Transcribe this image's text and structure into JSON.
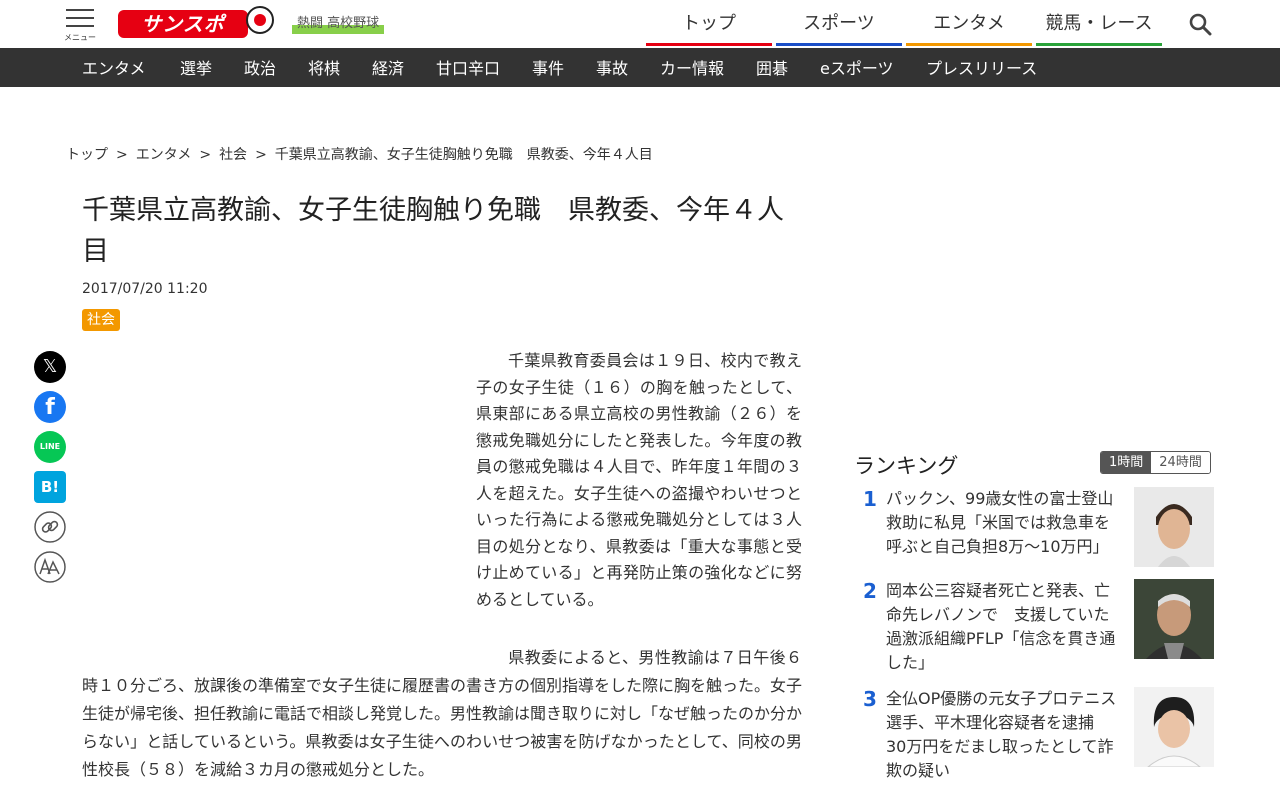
{
  "header": {
    "menu_label": "メニュー",
    "logo_text": "サンスポ",
    "highschool_badge": "熱闘 高校野球",
    "tabs": [
      {
        "label": "トップ",
        "color": "#e60012"
      },
      {
        "label": "スポーツ",
        "color": "#1a4fc8"
      },
      {
        "label": "エンタメ",
        "color": "#f39800"
      },
      {
        "label": "競馬・レース",
        "color": "#2aa33a"
      }
    ]
  },
  "subnav": {
    "items": [
      "エンタメ",
      "選挙",
      "政治",
      "将棋",
      "経済",
      "甘口辛口",
      "事件",
      "事故",
      "カー情報",
      "囲碁",
      "eスポーツ",
      "プレスリリース"
    ]
  },
  "breadcrumb": {
    "items": [
      "トップ",
      "エンタメ",
      "社会",
      "千葉県立高教諭、女子生徒胸触り免職　県教委、今年４人目"
    ],
    "separator": ">"
  },
  "article": {
    "title": "千葉県立高教諭、女子生徒胸触り免職　県教委、今年４人目",
    "date": "2017/07/20 11:20",
    "tag": "社会",
    "paragraphs": [
      "千葉県教育委員会は１９日、校内で教え子の女子生徒（１６）の胸を触ったとして、県東部にある県立高校の男性教諭（２６）を懲戒免職処分にしたと発表した。今年度の教員の懲戒免職は４人目で、昨年度１年間の３人を超えた。女子生徒への盗撮やわいせつといった行為による懲戒免職処分としては３人目の処分となり、県教委は「重大な事態と受け止めている」と再発防止策の強化などに努めるとしている。",
      "県教委によると、男性教諭は７日午後６時１０分ごろ、放課後の準備室で女子生徒に履歴書の書き方の個別指導をした際に胸を触った。女子生徒が帰宅後、担任教諭に電話で相談し発覚した。男性教諭は聞き取りに対し「なぜ触ったのか分からない」と話しているという。県教委は女子生徒へのわいせつ被害を防げなかったとして、同校の男性校長（５８）を減給３カ月の懲戒処分とした。"
    ]
  },
  "share": {
    "icons": [
      "x-icon",
      "facebook-icon",
      "line-icon",
      "hatena-bookmark-icon",
      "link-icon",
      "font-size-icon"
    ],
    "line_label": "LINE",
    "hatena_label": "B!",
    "x_label": "𝕏",
    "facebook_label": "f"
  },
  "ranking": {
    "title": "ランキング",
    "tabs": [
      "1時間",
      "24時間"
    ],
    "active_tab": "1時間",
    "items": [
      {
        "rank": "1",
        "text": "パックン、99歳女性の富士登山救助に私見「米国では救急車を呼ぶと自己負担8万～10万円」"
      },
      {
        "rank": "2",
        "text": "岡本公三容疑者死亡と発表、亡命先レバノンで　支援していた過激派組織PFLP「信念を貫き通した」"
      },
      {
        "rank": "3",
        "text": "全仏OP優勝の元女子プロテニス選手、平木理化容疑者を逮捕　30万円をだまし取ったとして詐欺の疑い"
      }
    ]
  }
}
